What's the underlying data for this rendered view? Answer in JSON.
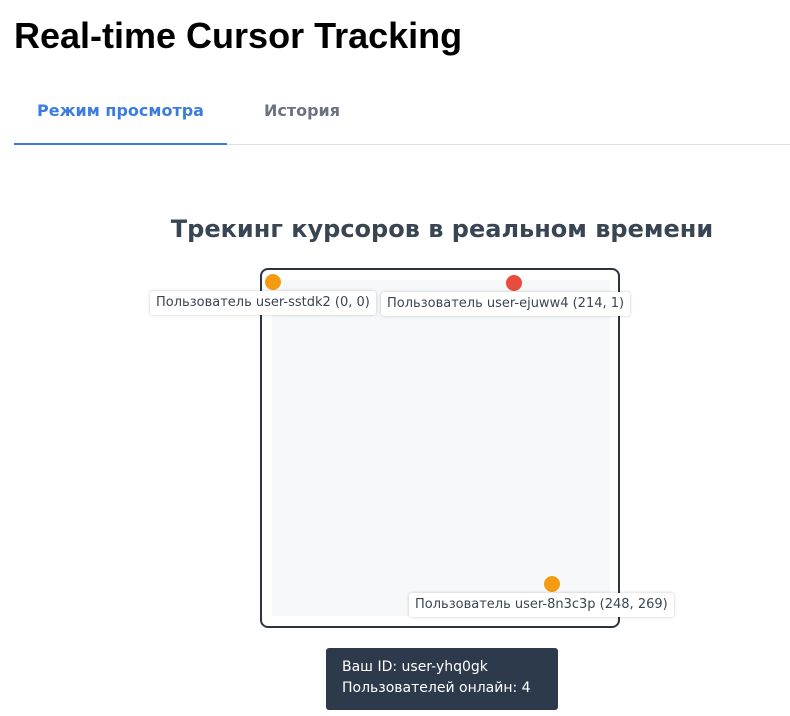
{
  "page": {
    "title": "Real-time Cursor Tracking"
  },
  "tabs": [
    {
      "label": "Режим просмотра",
      "active": true
    },
    {
      "label": "История",
      "active": false
    }
  ],
  "tracker": {
    "heading": "Трекинг курсоров в реальном времени",
    "cursors": [
      {
        "user": "user-sstdk2",
        "label": "Пользователь user-sstdk2 (0, 0)",
        "color": "#f39c12"
      },
      {
        "user": "user-8n3c3p",
        "label": "Пользователь user-8n3c3p (248, 269)",
        "color": "#f39c12"
      },
      {
        "user": "user-ejuww4",
        "label": "Пользователь user-ejuww4 (214, 1)",
        "color": "#e74c3c"
      }
    ]
  },
  "info": {
    "your_id": "Ваш ID: user-yhq0gk",
    "online": "Пользователей онлайн: 4"
  },
  "colors": {
    "accent": "#3b7ddd",
    "info_bg": "#2d3a4b",
    "cursor_orange": "#f39c12",
    "cursor_red": "#e74c3c"
  }
}
